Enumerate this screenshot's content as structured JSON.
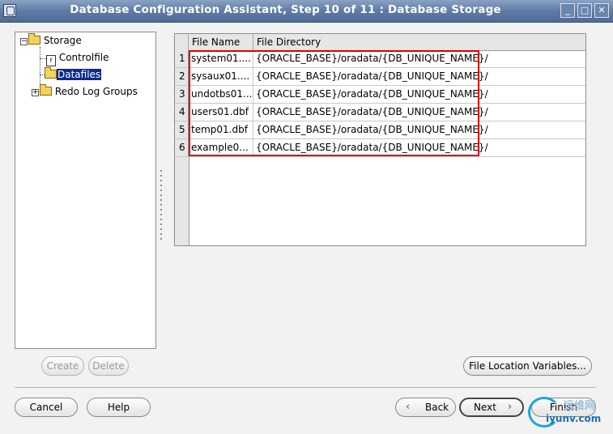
{
  "window": {
    "title": "Database Configuration Assistant, Step 10 of 11 : Database Storage",
    "min_label": "_",
    "max_label": "□",
    "close_label": "✕"
  },
  "tree": {
    "root_label": "Storage",
    "items": [
      {
        "label": "Controlfile",
        "icon": "document-icon"
      },
      {
        "label": "Datafiles",
        "icon": "folder-icon",
        "selected": true
      },
      {
        "label": "Redo Log Groups",
        "icon": "folder-icon"
      }
    ],
    "expand_collapsed": "+",
    "expand_open": "−",
    "doc_glyph": "f"
  },
  "table": {
    "columns": [
      "File Name",
      "File Directory"
    ],
    "rows": [
      {
        "num": "1",
        "name": "system01....",
        "dir": "{ORACLE_BASE}/oradata/{DB_UNIQUE_NAME}/"
      },
      {
        "num": "2",
        "name": "sysaux01....",
        "dir": "{ORACLE_BASE}/oradata/{DB_UNIQUE_NAME}/"
      },
      {
        "num": "3",
        "name": "undotbs01...",
        "dir": "{ORACLE_BASE}/oradata/{DB_UNIQUE_NAME}/"
      },
      {
        "num": "4",
        "name": "users01.dbf",
        "dir": "{ORACLE_BASE}/oradata/{DB_UNIQUE_NAME}/"
      },
      {
        "num": "5",
        "name": "temp01.dbf",
        "dir": "{ORACLE_BASE}/oradata/{DB_UNIQUE_NAME}/"
      },
      {
        "num": "6",
        "name": "example0...",
        "dir": "{ORACLE_BASE}/oradata/{DB_UNIQUE_NAME}/"
      }
    ]
  },
  "buttons": {
    "create": "Create",
    "delete": "Delete",
    "file_location": "File Location Variables...",
    "cancel": "Cancel",
    "help": "Help",
    "back": "Back",
    "next": "Next",
    "finish": "Finish",
    "back_chevron": "‹",
    "next_chevron": "›"
  },
  "watermark": {
    "text": "运维网",
    "url": "iyunv.com"
  },
  "colors": {
    "titlebar": "#5f7ba6",
    "selection": "#0a2a8f",
    "highlight": "#dd0000"
  }
}
